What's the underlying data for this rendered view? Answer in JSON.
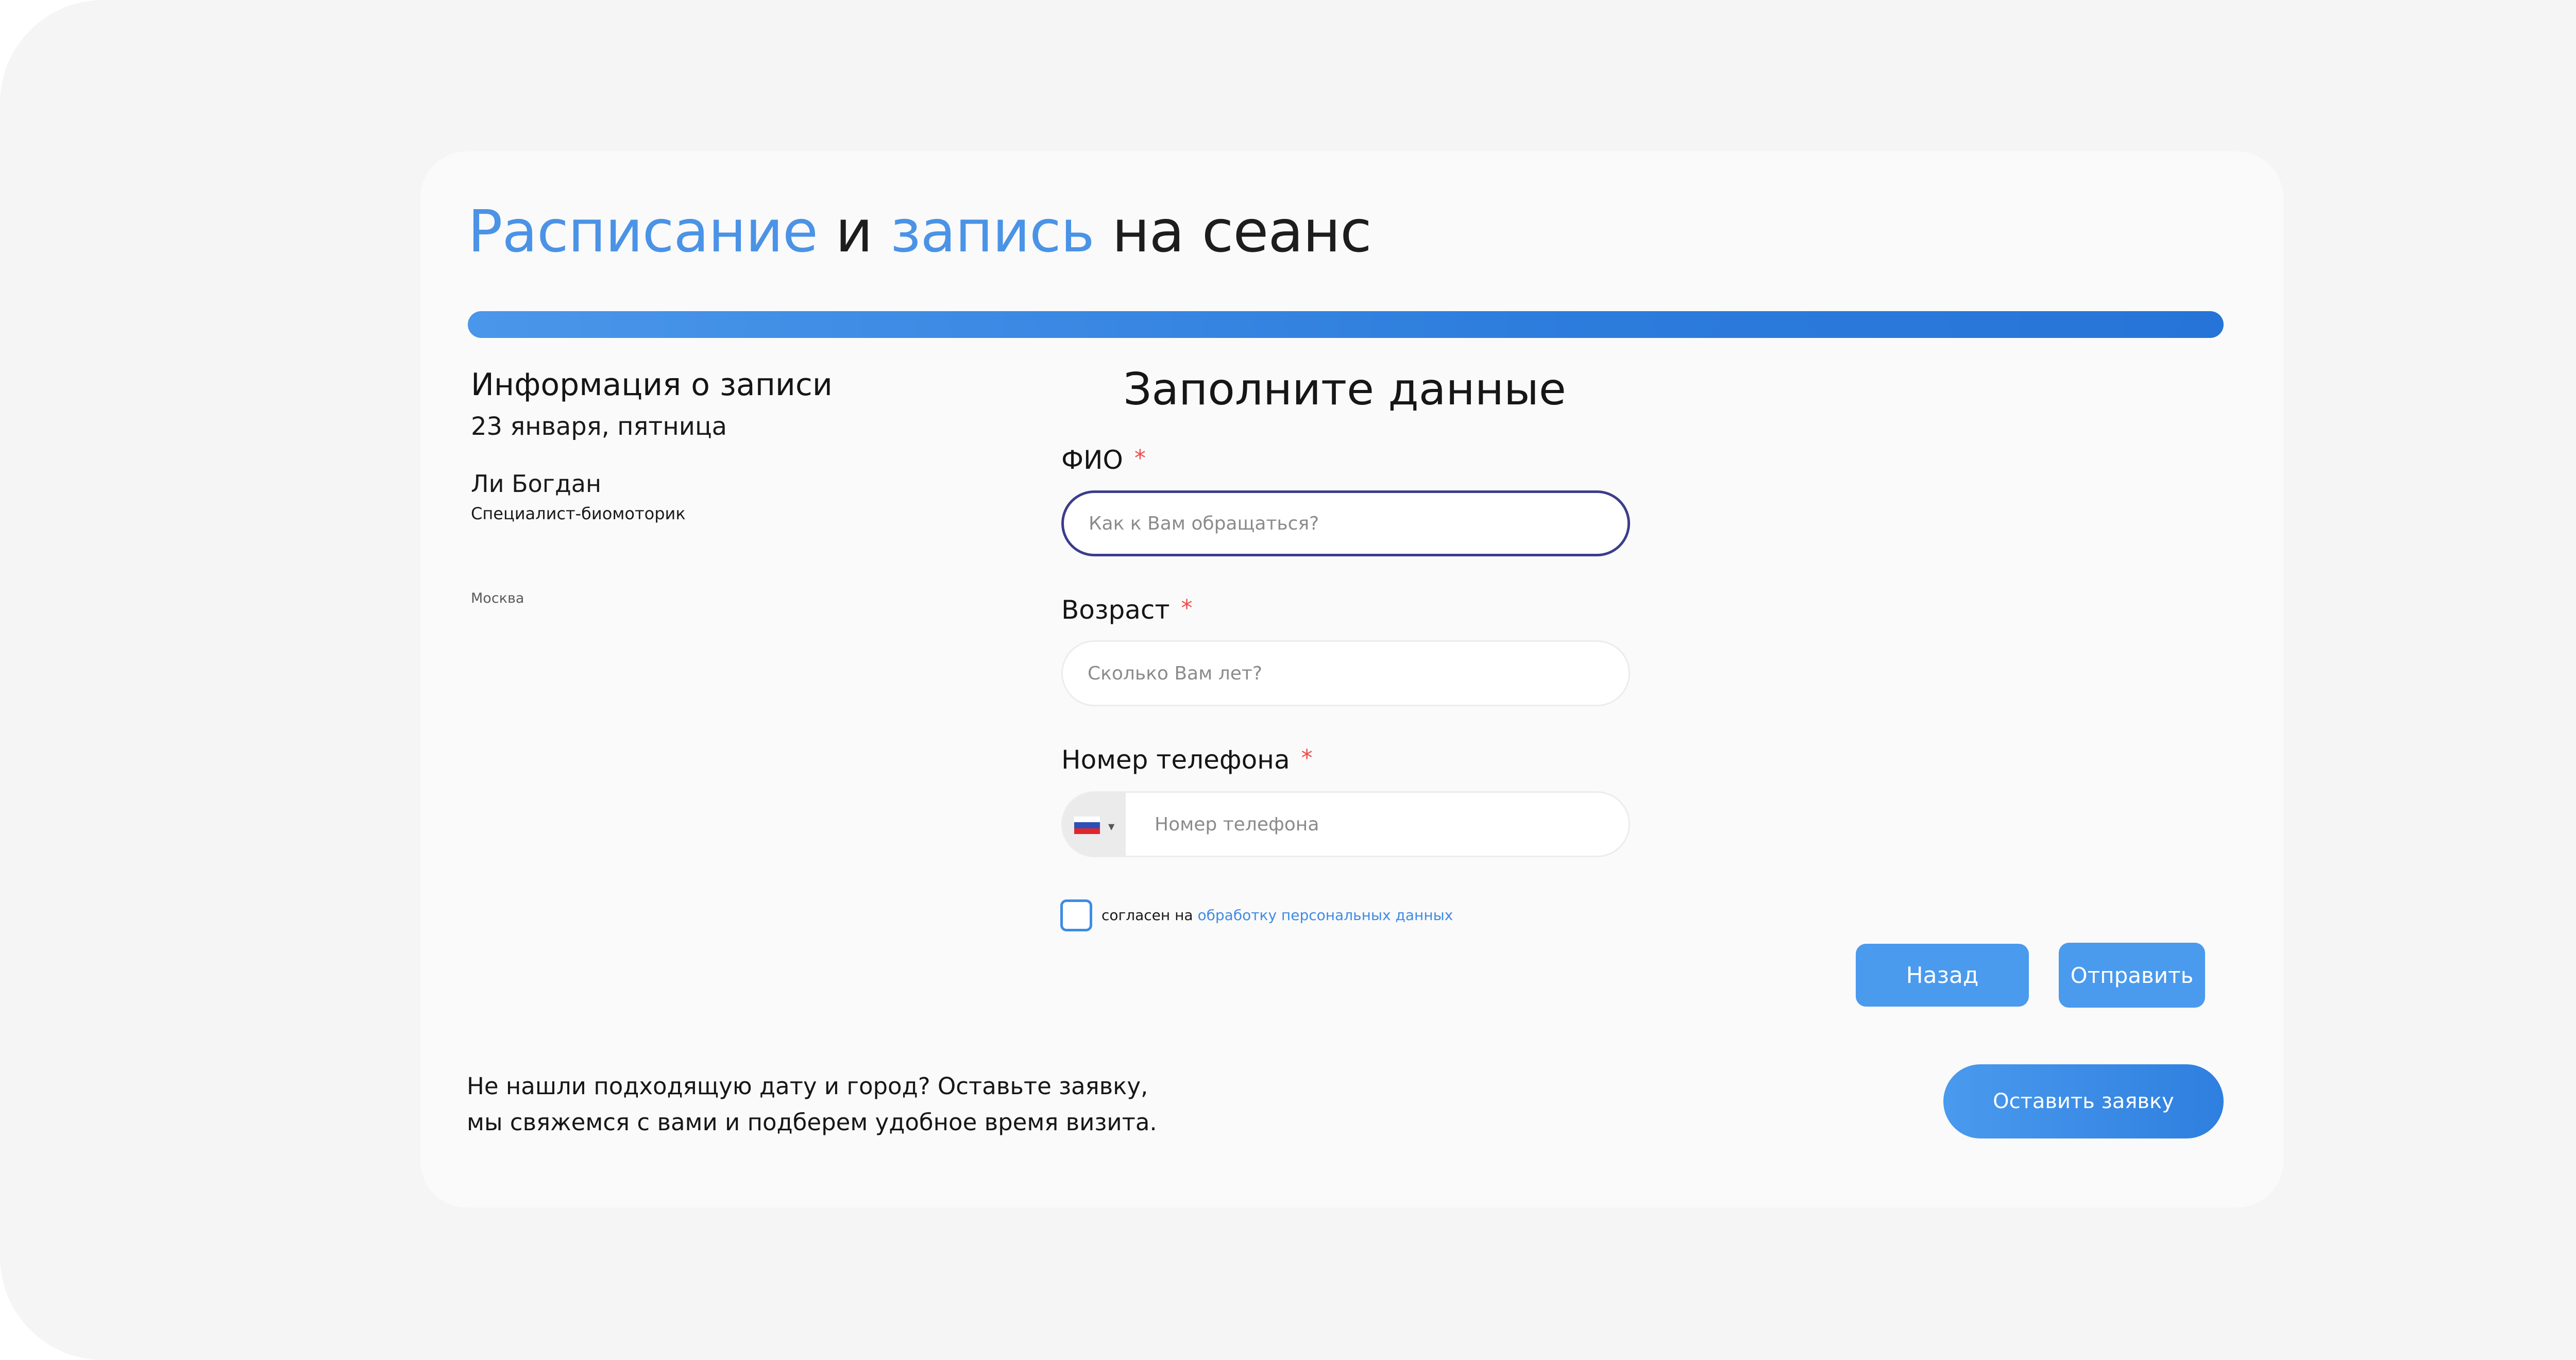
{
  "header": {
    "title_part1": "Расписание",
    "title_part2": "и",
    "title_part3": "запись",
    "title_part4": "на сеанс"
  },
  "progress": {
    "value": 1.0
  },
  "info": {
    "title": "Информация о записи",
    "date": "23 января, пятница",
    "specialist_name": "Ли Богдан",
    "specialist_role": "Специалист-биомоторик",
    "city": "Москва"
  },
  "form": {
    "title": "Заполните данные",
    "required_mark": "*",
    "name": {
      "label": "ФИО",
      "placeholder": "Как к Вам обращаться?",
      "value": ""
    },
    "age": {
      "label": "Возраст",
      "placeholder": "Сколько Вам лет?",
      "value": ""
    },
    "phone": {
      "label": "Номер телефона",
      "placeholder": "Номер телефона",
      "value": "",
      "country": "RU"
    },
    "consent": {
      "text": "согласен на",
      "link": "обработку персональных данных",
      "checked": false
    },
    "back_label": "Назад",
    "submit_label": "Отправить"
  },
  "footer": {
    "text": "Не нашли подходящую дату и город? Оставьте заявку, мы свяжемся с вами и подберем удобное время визита.",
    "request_label": "Оставить заявку"
  },
  "colors": {
    "accent": "#4a93e6",
    "required": "#ef4b4b",
    "focus_border": "#3c3c8c"
  },
  "icons": {
    "country_flag": "russia-flag-icon",
    "dropdown": "caret-down-icon"
  }
}
